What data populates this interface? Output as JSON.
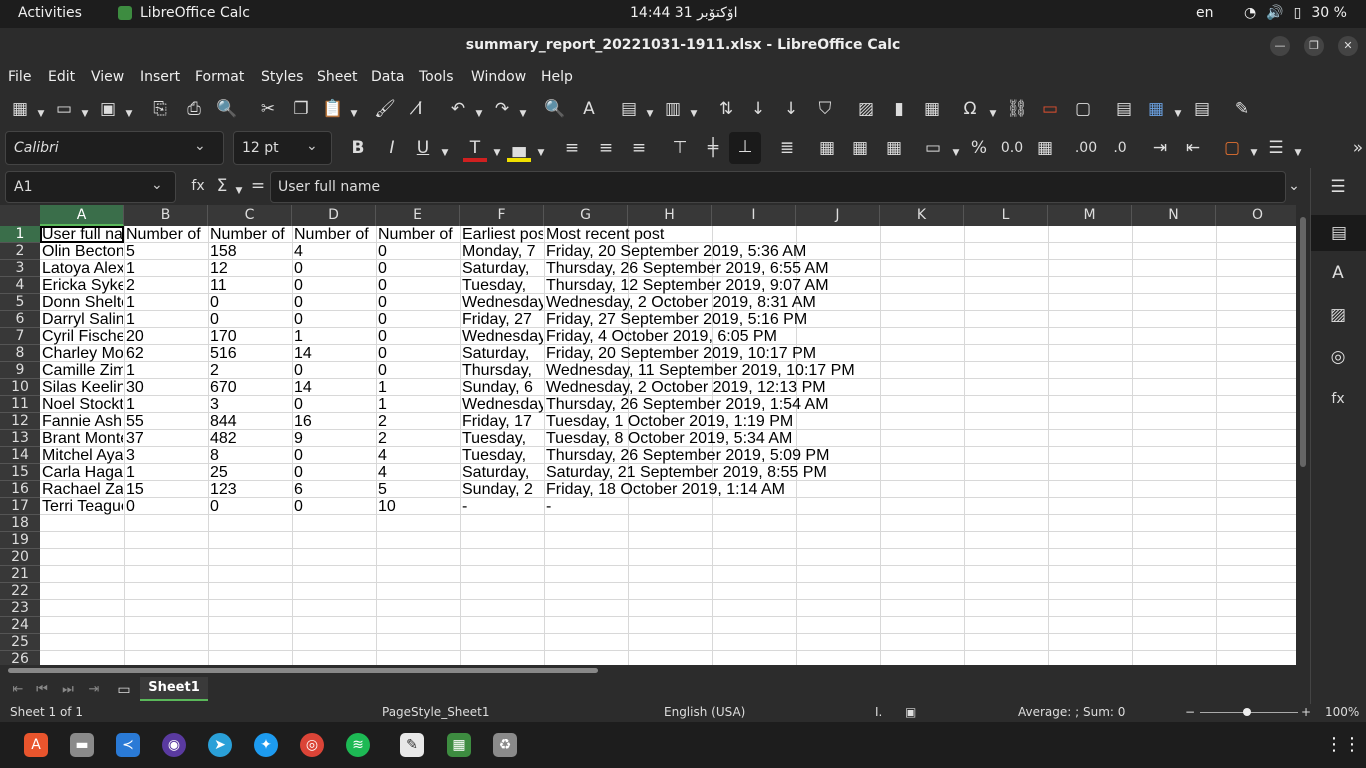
{
  "topbar": {
    "activities": "Activities",
    "app_name": "LibreOffice Calc",
    "clock": "14:44  31 اۆکتۆبر",
    "lang": "en",
    "battery": "30 %"
  },
  "window": {
    "title": "summary_report_20221031-1911.xlsx - LibreOffice Calc"
  },
  "menu": [
    "File",
    "Edit",
    "View",
    "Insert",
    "Format",
    "Styles",
    "Sheet",
    "Data",
    "Tools",
    "Window",
    "Help"
  ],
  "font": {
    "name": "Calibri",
    "size": "12 pt"
  },
  "formula": {
    "cell_ref": "A1",
    "content": "User full name"
  },
  "columns": [
    "A",
    "B",
    "C",
    "D",
    "E",
    "F",
    "G",
    "H",
    "I",
    "J",
    "K",
    "L",
    "M",
    "N",
    "O"
  ],
  "rows": [
    "1",
    "2",
    "3",
    "4",
    "5",
    "6",
    "7",
    "8",
    "9",
    "10",
    "11",
    "12",
    "13",
    "14",
    "15",
    "16",
    "17",
    "18",
    "19",
    "20",
    "21",
    "22",
    "23",
    "24",
    "25",
    "26"
  ],
  "table": {
    "header": [
      "User full name",
      "Number of",
      "Number of",
      "Number of",
      "Number of",
      "Earliest post",
      "Most recent post"
    ],
    "rows": [
      [
        "Olin Becton",
        "5",
        "158",
        "4",
        "0",
        "Monday, 7",
        "Friday, 20 September 2019, 5:36 AM"
      ],
      [
        "Latoya Alexander",
        "1",
        "12",
        "0",
        "0",
        "Saturday,",
        "Thursday, 26 September 2019, 6:55 AM"
      ],
      [
        "Ericka Sykes",
        "2",
        "11",
        "0",
        "0",
        "Tuesday,",
        "Thursday, 12 September 2019, 9:07 AM"
      ],
      [
        "Donn Shelton",
        "1",
        "0",
        "0",
        "0",
        "Wednesday",
        "Wednesday, 2 October 2019, 8:31 AM"
      ],
      [
        "Darryl Salinas",
        "1",
        "0",
        "0",
        "0",
        "Friday, 27",
        "Friday, 27 September 2019, 5:16 PM"
      ],
      [
        "Cyril Fischer",
        "20",
        "170",
        "1",
        "0",
        "Wednesday",
        "Friday, 4 October 2019, 6:05 PM"
      ],
      [
        "Charley Moody",
        "62",
        "516",
        "14",
        "0",
        "Saturday,",
        "Friday, 20 September 2019, 10:17 PM"
      ],
      [
        "Camille Zimmerman",
        "1",
        "2",
        "0",
        "0",
        "Thursday,",
        "Wednesday, 11 September 2019, 10:17 PM"
      ],
      [
        "Silas Keeling",
        "30",
        "670",
        "14",
        "1",
        "Sunday, 6",
        "Wednesday, 2 October 2019, 12:13 PM"
      ],
      [
        "Noel Stockton",
        "1",
        "3",
        "0",
        "1",
        "Wednesday",
        "Thursday, 26 September 2019, 1:54 AM"
      ],
      [
        "Fannie Ashley",
        "55",
        "844",
        "16",
        "2",
        "Friday, 17",
        "Tuesday, 1 October 2019, 1:19 PM"
      ],
      [
        "Brant Montes",
        "37",
        "482",
        "9",
        "2",
        "Tuesday,",
        "Tuesday, 8 October 2019, 5:34 AM"
      ],
      [
        "Mitchel Ayala",
        "3",
        "8",
        "0",
        "4",
        "Tuesday,",
        "Thursday, 26 September 2019, 5:09 PM"
      ],
      [
        "Carla Hagan",
        "1",
        "25",
        "0",
        "4",
        "Saturday,",
        "Saturday, 21 September 2019, 8:55 PM"
      ],
      [
        "Rachael Zamora",
        "15",
        "123",
        "6",
        "5",
        "Sunday, 2",
        "Friday, 18 October 2019, 1:14 AM"
      ],
      [
        "Terri Teague",
        "0",
        "0",
        "0",
        "10",
        "-",
        "-"
      ]
    ]
  },
  "sheet_tab": "Sheet1",
  "status": {
    "sheet": "Sheet 1 of 1",
    "page_style": "PageStyle_Sheet1",
    "language": "English (USA)",
    "summary": "Average: ; Sum: 0",
    "zoom": "100%"
  },
  "colors": {
    "accent": "#5ab85a",
    "dark_bg": "#2c2c2c"
  }
}
